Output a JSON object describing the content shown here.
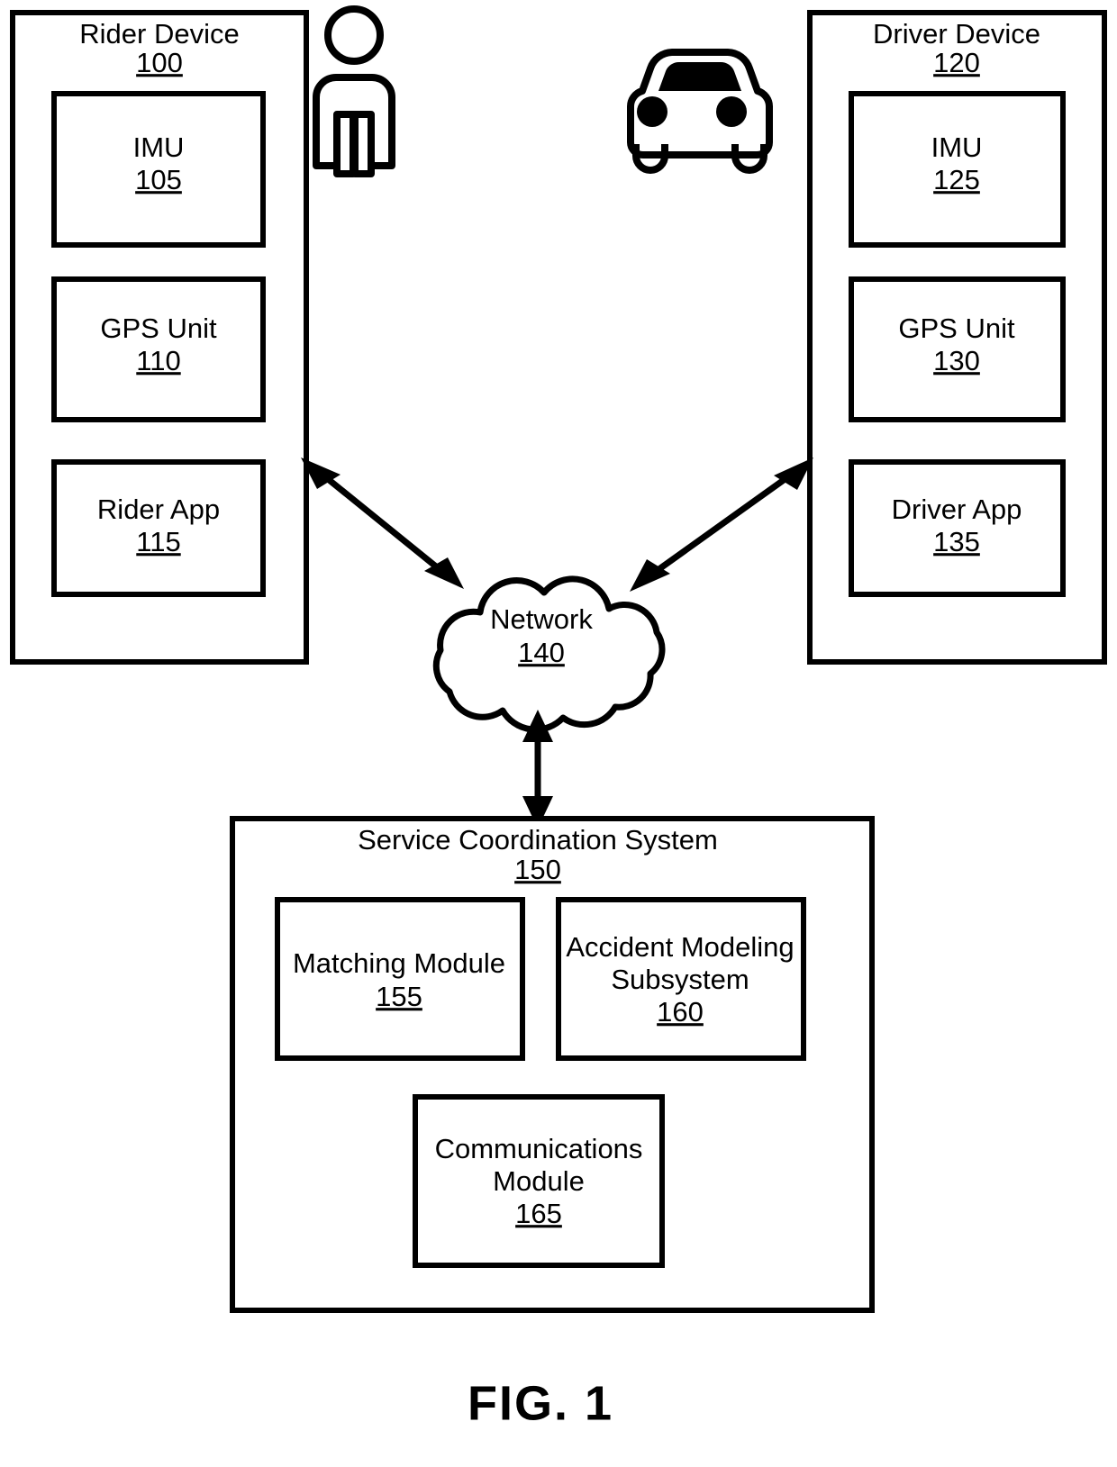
{
  "figure": {
    "caption": "FIG. 1",
    "background_color": "#ffffff",
    "line_color": "#000000"
  },
  "nodes": {
    "rider_device": {
      "label": "Rider Device",
      "ref": "100",
      "children": [
        {
          "label": "IMU",
          "ref": "105"
        },
        {
          "label": "GPS Unit",
          "ref": "110"
        },
        {
          "label": "Rider App",
          "ref": "115"
        }
      ]
    },
    "driver_device": {
      "label": "Driver Device",
      "ref": "120",
      "children": [
        {
          "label": "IMU",
          "ref": "125"
        },
        {
          "label": "GPS Unit",
          "ref": "130"
        },
        {
          "label": "Driver App",
          "ref": "135"
        }
      ]
    },
    "network": {
      "label": "Network",
      "ref": "140"
    },
    "service_coordination_system": {
      "label": "Service Coordination System",
      "ref": "150",
      "children": [
        {
          "label_line1": "Matching Module",
          "label_line2": "",
          "ref": "155"
        },
        {
          "label_line1": "Accident Modeling",
          "label_line2": "Subsystem",
          "ref": "160"
        },
        {
          "label_line1": "Communications",
          "label_line2": "Module",
          "ref": "165"
        }
      ]
    }
  },
  "icons": {
    "rider_person": "person-icon",
    "driver_car": "car-icon"
  },
  "connections": [
    {
      "from": "rider_device",
      "to": "network",
      "style": "double-arrow"
    },
    {
      "from": "driver_device",
      "to": "network",
      "style": "double-arrow"
    },
    {
      "from": "network",
      "to": "service_coordination_system",
      "style": "double-arrow"
    }
  ]
}
